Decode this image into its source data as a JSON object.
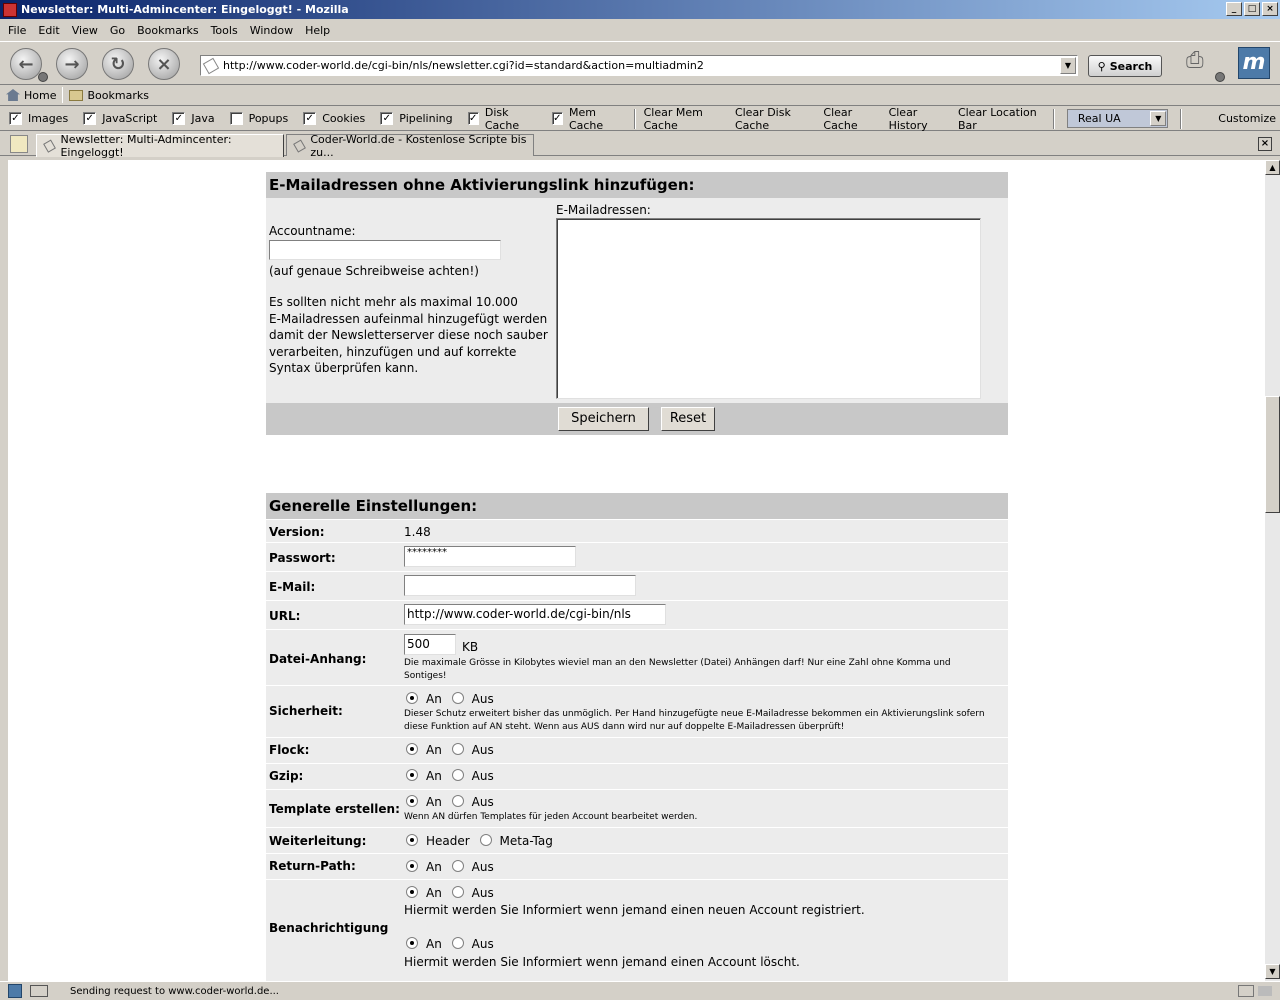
{
  "window": {
    "title": "Newsletter: Multi-Admincenter: Eingeloggt! - Mozilla",
    "min": "_",
    "max": "□",
    "close": "×"
  },
  "menu": [
    "File",
    "Edit",
    "View",
    "Go",
    "Bookmarks",
    "Tools",
    "Window",
    "Help"
  ],
  "nav": {
    "back_icon": "back-arrow-icon",
    "forward_icon": "forward-arrow-icon",
    "reload_icon": "reload-icon",
    "stop_icon": "stop-icon",
    "url": "http://www.coder-world.de/cgi-bin/nls/newsletter.cgi?id=standard&action=multiadmin2",
    "search_label": "Search"
  },
  "personal": {
    "home": "Home",
    "bookmarks": "Bookmarks"
  },
  "prefbar": {
    "checks": [
      {
        "label": "Images",
        "checked": true
      },
      {
        "label": "JavaScript",
        "checked": true
      },
      {
        "label": "Java",
        "checked": true
      },
      {
        "label": "Popups",
        "checked": false
      },
      {
        "label": "Cookies",
        "checked": true
      },
      {
        "label": "Pipelining",
        "checked": true
      },
      {
        "label": "Disk Cache",
        "checked": true
      },
      {
        "label": "Mem Cache",
        "checked": true
      }
    ],
    "buttons": [
      "Clear Mem Cache",
      "Clear Disk Cache",
      "Clear Cache",
      "Clear History",
      "Clear Location Bar"
    ],
    "ua": "Real UA",
    "customize": "Customize"
  },
  "tabs": [
    {
      "label": "Newsletter: Multi-Admincenter: Eingeloggt!",
      "active": true
    },
    {
      "label": "Coder-World.de - Kostenlose Scripte bis zu...",
      "active": false
    }
  ],
  "add_emails": {
    "heading": "E-Mailadressen ohne Aktivierungslink hinzufügen:",
    "account_label": "Accountname:",
    "account_value": "",
    "hint": "(auf genaue Schreibweise achten!)",
    "info_lines": [
      "Es sollten nicht mehr als maximal 10.000",
      "E-Mailadressen aufeinmal hinzugefügt werden",
      "damit der Newsletterserver diese noch sauber",
      "verarbeiten, hinzufügen und auf korrekte",
      "Syntax überprüfen kann."
    ],
    "emails_label": "E-Mailadressen:",
    "emails_value": "",
    "save": "Speichern",
    "reset": "Reset"
  },
  "general": {
    "heading": "Generelle Einstellungen:",
    "version_label": "Version:",
    "version": "1.48",
    "password_label": "Passwort:",
    "password": "********",
    "email_label": "E-Mail:",
    "email": "",
    "url_label": "URL:",
    "url": "http://www.coder-world.de/cgi-bin/nls",
    "attach_label": "Datei-Anhang:",
    "attach": "500",
    "attach_unit": "KB",
    "attach_note_1": "Die maximale Grösse in Kilobytes wieviel man an den Newsletter (Datei) Anhängen darf! Nur eine Zahl ohne Komma und",
    "attach_note_2": "Sontiges!",
    "security_label": "Sicherheit:",
    "security_note_1": "Dieser Schutz erweitert bisher das unmöglich. Per Hand hinzugefügte neue E-Mailadresse bekommen ein Aktivierungslink sofern",
    "security_note_2": "diese Funktion auf AN steht. Wenn aus AUS dann wird nur auf doppelte E-Mailadressen überprüft!",
    "flock_label": "Flock:",
    "gzip_label": "Gzip:",
    "template_label": "Template erstellen:",
    "template_note": "Wenn AN dürfen Templates für jeden Account bearbeitet werden.",
    "forward_label": "Weiterleitung:",
    "forward_a": "Header",
    "forward_b": "Meta-Tag",
    "returnpath_label": "Return-Path:",
    "notify_label": "Benachrichtigung",
    "notify_note_1": "Hiermit werden Sie Informiert wenn jemand einen neuen Account registriert.",
    "notify_note_2": "Hiermit werden Sie Informiert wenn jemand einen Account löscht.",
    "on": "An",
    "off": "Aus"
  },
  "status": {
    "text": "Sending request to www.coder-world.de..."
  }
}
